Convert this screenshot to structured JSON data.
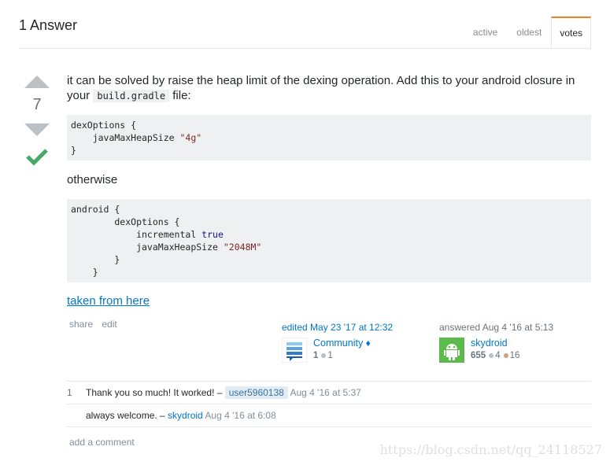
{
  "header": {
    "title": "1 Answer",
    "tabs": [
      {
        "label": "active"
      },
      {
        "label": "oldest"
      },
      {
        "label": "votes"
      }
    ]
  },
  "vote": {
    "count": "7",
    "accepted": true
  },
  "answer": {
    "p1_before": "it can be solved by raise the heap limit of the dexing operation. Add this to your android closure in your ",
    "p1_code": "build.gradle",
    "p1_after": " file:",
    "code1": {
      "l1": "dexOptions {",
      "l2_pre": "    javaMaxHeapSize ",
      "l2_str": "\"4g\"",
      "l3": "}"
    },
    "p2": "otherwise",
    "code2": {
      "l1": "android {",
      "l2": "        dexOptions {",
      "l3_pre": "            incremental ",
      "l3_kw": "true",
      "l4_pre": "            javaMaxHeapSize ",
      "l4_str": "\"2048M\"",
      "l5": "        }",
      "l6": "    }"
    },
    "link_text": "taken from here"
  },
  "post_menu": {
    "share": "share",
    "edit": "edit"
  },
  "edited": {
    "action": "edited May 23 '17 at 12:32",
    "user": "Community",
    "diamond": "♦",
    "rep": "1",
    "silver": "1"
  },
  "answered": {
    "action": "answered Aug 4 '16 at 5:13",
    "user": "skydroid",
    "rep": "655",
    "silver": "4",
    "bronze": "16"
  },
  "comments": [
    {
      "score": "1",
      "text": "Thank you so much! It worked! – ",
      "user": "user5960138",
      "date": "Aug 4 '16 at 5:37"
    },
    {
      "score": "",
      "text": "always welcome. – ",
      "user": "skydroid",
      "date": "Aug 4 '16 at 6:08"
    }
  ],
  "add_comment": "add a comment",
  "watermark": "https://blog.csdn.net/qq_24118527",
  "colors": {
    "link": "#0077cc",
    "accepted": "#48a868",
    "tab_accent": "#f48024"
  }
}
